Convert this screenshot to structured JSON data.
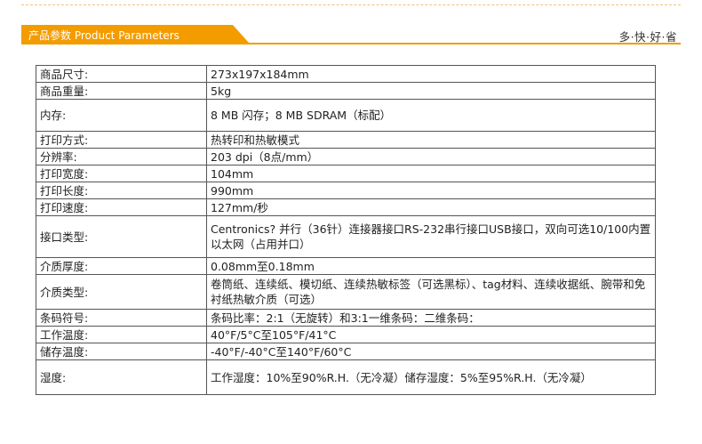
{
  "header": {
    "title": "产品参数 Product Parameters",
    "slogan": "多·快·好·省",
    "accent_color": "#f39c00"
  },
  "params": [
    {
      "label": "商品尺寸:",
      "value": "273x197x184mm"
    },
    {
      "label": "商品重量:",
      "value": "5kg"
    },
    {
      "label": "内存:",
      "value": "8 MB 闪存；8 MB SDRAM（标配）"
    },
    {
      "label": "打印方式:",
      "value": "热转印和热敏模式"
    },
    {
      "label": "分辨率:",
      "value": "203 dpi（8点/mm）"
    },
    {
      "label": "打印宽度:",
      "value": "104mm"
    },
    {
      "label": "打印长度:",
      "value": "990mm"
    },
    {
      "label": "打印速度:",
      "value": "127mm/秒"
    },
    {
      "label": "接口类型:",
      "value": "Centronics? 并行（36针）连接器接口RS-232串行接口USB接口，双向可选10/100内置以太网（占用并口）"
    },
    {
      "label": "介质厚度:",
      "value": "0.08mm至0.18mm"
    },
    {
      "label": "介质类型:",
      "value": "卷筒纸、连续纸、模切纸、连续热敏标签（可选黑标）、tag材料、连续收据纸、腕带和免衬纸热敏介质（可选）"
    },
    {
      "label": "条码符号:",
      "value": "条码比率：2:1（无旋转）和3:1一维条码：二维条码："
    },
    {
      "label": "工作温度:",
      "value": "40°F/5°C至105°F/41°C"
    },
    {
      "label": "储存温度:",
      "value": "-40°F/-40°C至140°F/60°C"
    },
    {
      "label": "湿度:",
      "value": "工作湿度：10%至90%R.H.（无冷凝）储存湿度：5%至95%R.H.（无冷凝）"
    }
  ]
}
